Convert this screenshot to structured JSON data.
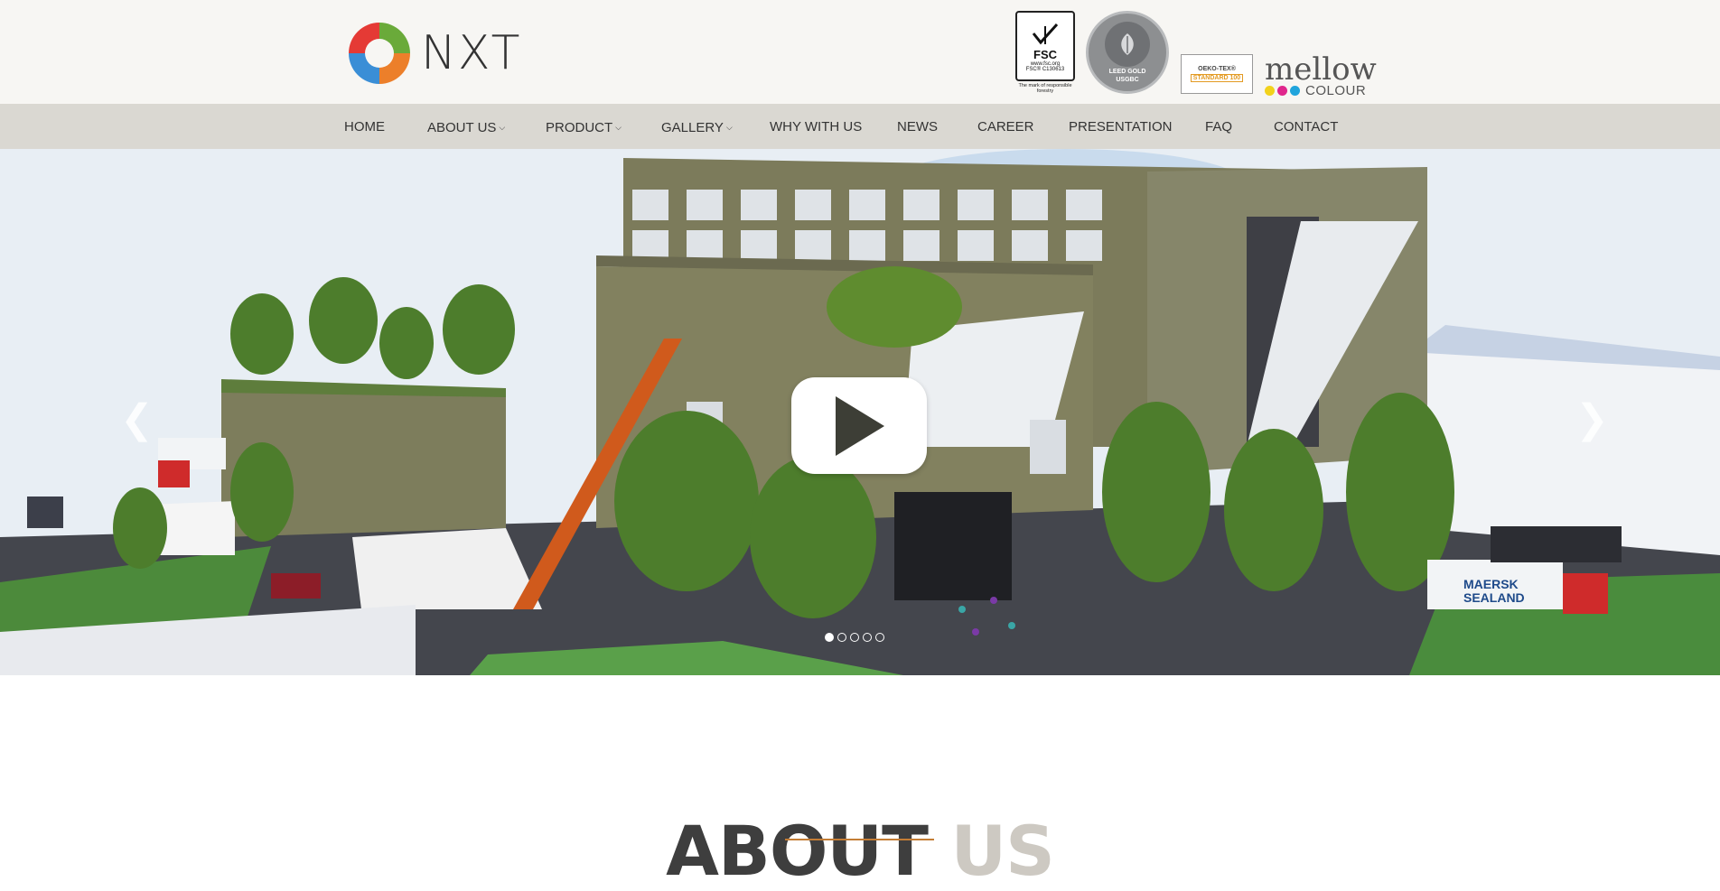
{
  "brand": {
    "name": "NXT"
  },
  "certifications": {
    "fsc": {
      "label": "FSC",
      "site": "www.fsc.org",
      "code": "FSC® C130613",
      "caption": "The mark of responsible forestry"
    },
    "usgbc": {
      "text": "LEED GOLD",
      "short": "USGBC"
    },
    "oeko": {
      "title": "OEKO-TEX®",
      "standard": "STANDARD 100"
    },
    "mellow": {
      "word": "mellow",
      "colour": "COLOUR",
      "colors": [
        "#f2d21c",
        "#e0268c",
        "#20a4dc"
      ]
    }
  },
  "nav": [
    {
      "label": "HOME",
      "dropdown": false
    },
    {
      "label": "ABOUT US",
      "dropdown": true
    },
    {
      "label": "PRODUCT",
      "dropdown": true
    },
    {
      "label": "GALLERY",
      "dropdown": true
    },
    {
      "label": "WHY WITH US",
      "dropdown": false
    },
    {
      "label": "NEWS",
      "dropdown": false
    },
    {
      "label": "CAREER",
      "dropdown": false
    },
    {
      "label": "PRESENTATION",
      "dropdown": false
    },
    {
      "label": "FAQ",
      "dropdown": false
    },
    {
      "label": "CONTACT",
      "dropdown": false
    }
  ],
  "hero": {
    "prev_icon": "chevron-left-icon",
    "next_icon": "chevron-right-icon",
    "play_icon": "play-icon",
    "slides": 5,
    "active_slide": 1,
    "truck_label_1": "MAERSK",
    "truck_label_2": "SEALAND"
  },
  "about": {
    "title_part1": "ABOUT",
    "title_part2": "US"
  },
  "colors": {
    "accent": "#c47d35",
    "nav_bg": "#dad8d2",
    "header_bg": "#f7f6f3"
  }
}
